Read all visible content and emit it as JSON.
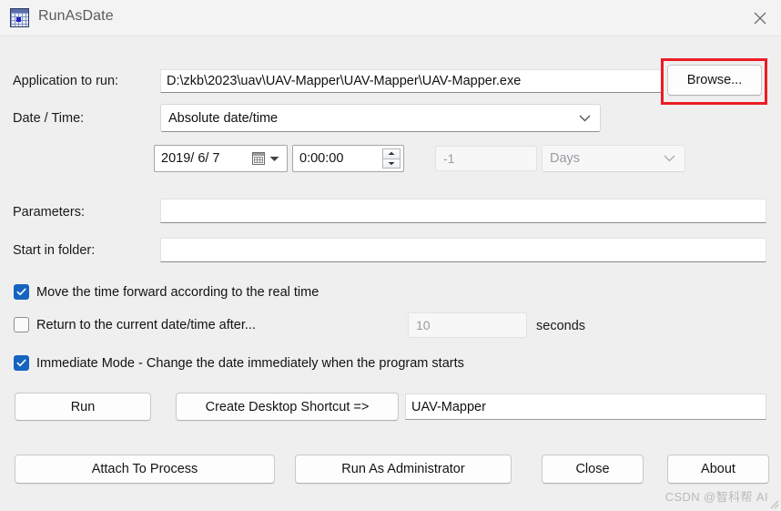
{
  "window": {
    "title": "RunAsDate",
    "icon": "calendar-grid-icon",
    "close_label": "✕"
  },
  "form": {
    "application_label": "Application to run:",
    "application_value": "D:\\zkb\\2023\\uav\\UAV-Mapper\\UAV-Mapper\\UAV-Mapper.exe",
    "browse_label": "Browse...",
    "datetime_label": "Date / Time:",
    "datetime_mode": "Absolute date/time",
    "date_value": "2019/ 6/ 7",
    "time_value": "0:00:00",
    "offset_value": "-1",
    "offset_unit": "Days",
    "parameters_label": "Parameters:",
    "parameters_value": "",
    "start_folder_label": "Start in folder:",
    "start_folder_value": ""
  },
  "options": {
    "move_forward": {
      "label": "Move the time forward according to the real time",
      "checked": true
    },
    "return_after": {
      "label": "Return to the current date/time after...",
      "checked": false,
      "seconds_value": "10",
      "seconds_label": "seconds"
    },
    "immediate_mode": {
      "label": "Immediate Mode - Change the date immediately when the program starts",
      "checked": true
    }
  },
  "actions": {
    "run": "Run",
    "create_shortcut": "Create Desktop Shortcut =>",
    "shortcut_name": "UAV-Mapper",
    "attach_to_process": "Attach To Process",
    "run_as_admin": "Run As Administrator",
    "close": "Close",
    "about": "About"
  },
  "watermark": "CSDN @智科帮 AI",
  "colors": {
    "window_bg": "#efeff0",
    "titlebar_bg": "#f3f3f3",
    "checkbox_accent": "#1664c0",
    "annotation_red": "#ec1c24",
    "disabled_text": "#9a9ba2"
  }
}
